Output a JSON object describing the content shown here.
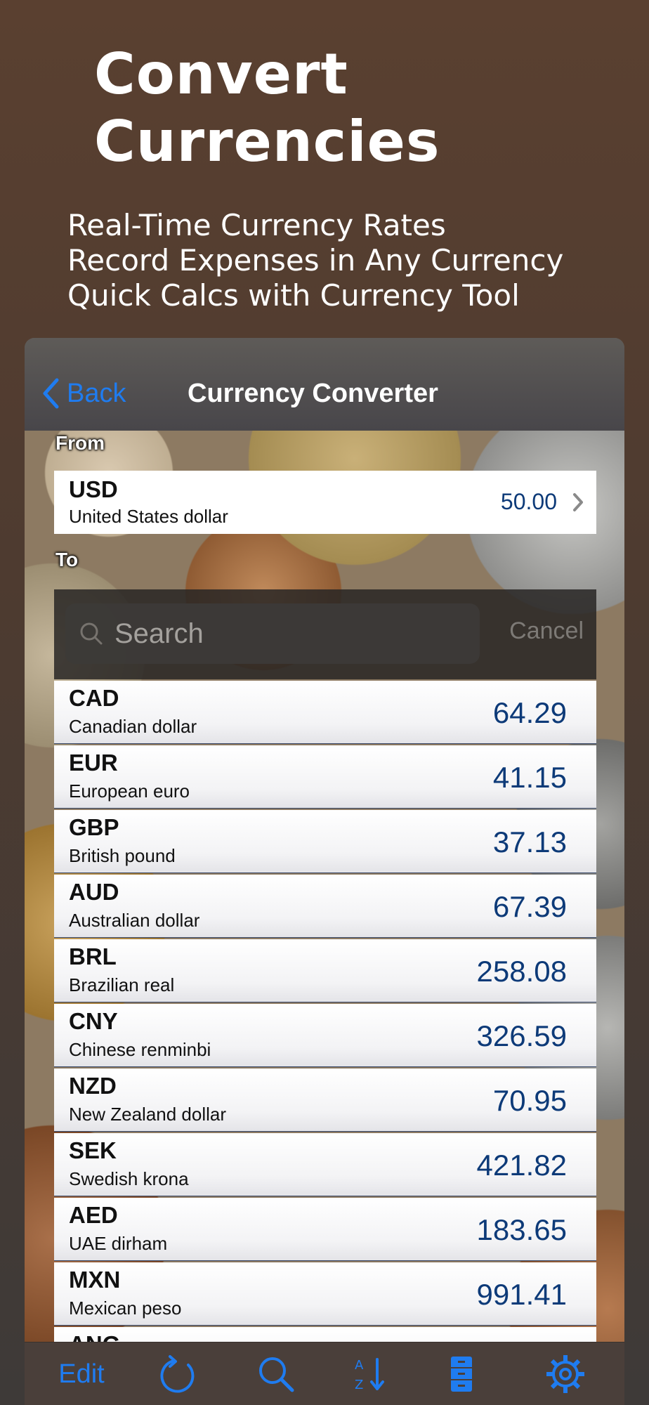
{
  "promo": {
    "title_line1": "Convert",
    "title_line2": "Currencies",
    "features": [
      "Real-Time Currency Rates",
      "Record Expenses in Any Currency",
      "Quick Calcs with Currency Tool"
    ]
  },
  "nav": {
    "back_label": "Back",
    "title": "Currency Converter"
  },
  "from": {
    "section_label": "From",
    "code": "USD",
    "name": "United States dollar",
    "amount": "50.00"
  },
  "to": {
    "section_label": "To"
  },
  "search": {
    "placeholder": "Search",
    "cancel_label": "Cancel"
  },
  "currencies": [
    {
      "code": "CAD",
      "name": "Canadian dollar",
      "value": "64.29"
    },
    {
      "code": "EUR",
      "name": "European euro",
      "value": "41.15"
    },
    {
      "code": "GBP",
      "name": "British pound",
      "value": "37.13"
    },
    {
      "code": "AUD",
      "name": "Australian dollar",
      "value": "67.39"
    },
    {
      "code": "BRL",
      "name": "Brazilian real",
      "value": "258.08"
    },
    {
      "code": "CNY",
      "name": "Chinese renminbi",
      "value": "326.59"
    },
    {
      "code": "NZD",
      "name": "New Zealand dollar",
      "value": "70.95"
    },
    {
      "code": "SEK",
      "name": "Swedish krona",
      "value": "421.82"
    },
    {
      "code": "AED",
      "name": "UAE dirham",
      "value": "183.65"
    },
    {
      "code": "MXN",
      "name": "Mexican peso",
      "value": "991.41"
    },
    {
      "code": "ANG",
      "name": "",
      "value": ""
    }
  ],
  "toolbar": {
    "edit_label": "Edit",
    "icons": [
      "refresh-icon",
      "search-icon",
      "sort-az-icon",
      "cabinet-icon",
      "gear-icon"
    ]
  },
  "colors": {
    "accent": "#1f7cf0",
    "value_text": "#0d3a78",
    "background": "#4e3b30"
  }
}
